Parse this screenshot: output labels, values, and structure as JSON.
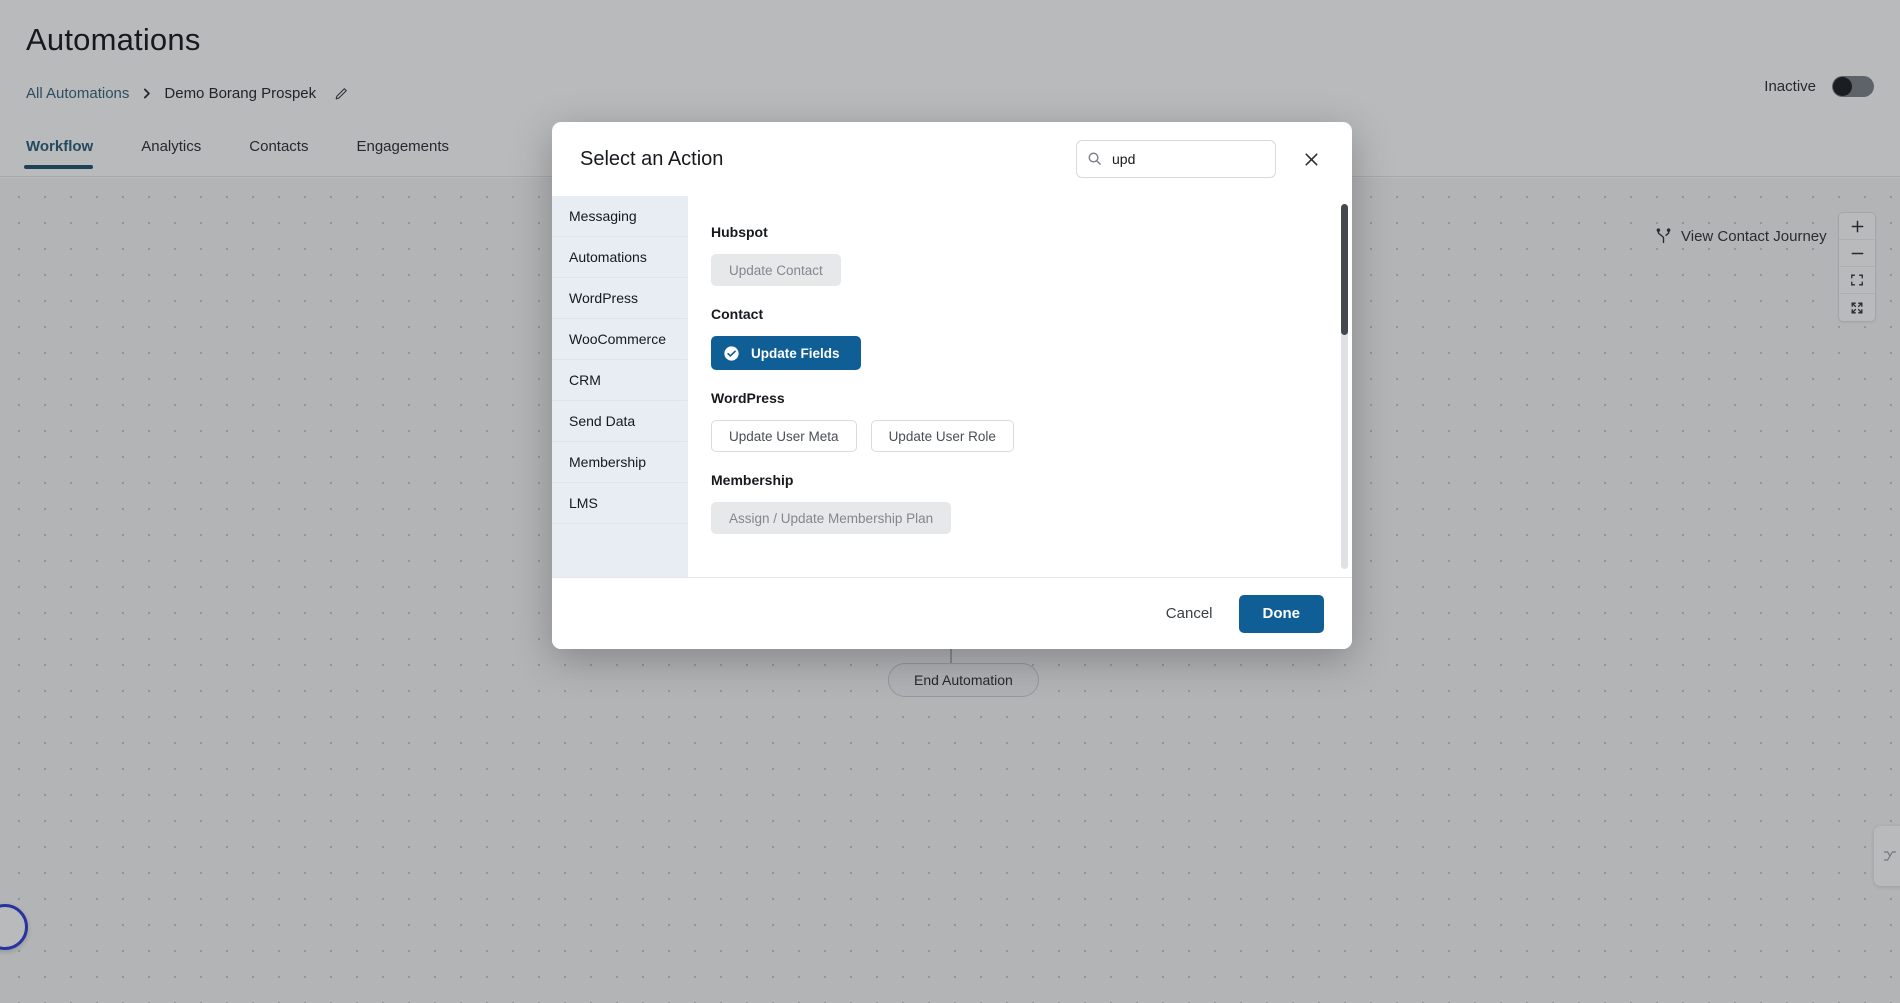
{
  "page": {
    "title": "Automations",
    "breadcrumb": {
      "root_label": "All Automations",
      "separator": "›",
      "current_label": "Demo Borang Prospek",
      "edit_icon": "pencil-icon"
    },
    "tabs": [
      {
        "label": "Workflow",
        "active": true
      },
      {
        "label": "Analytics",
        "active": false
      },
      {
        "label": "Contacts",
        "active": false
      },
      {
        "label": "Engagements",
        "active": false
      }
    ],
    "status": {
      "label": "Inactive",
      "enabled": false
    }
  },
  "canvas": {
    "view_journey_label": "View Contact Journey",
    "view_journey_icon": "journey-branch-icon",
    "zoom_controls": [
      {
        "icon": "plus-icon",
        "name": "zoom-in-button"
      },
      {
        "icon": "minus-icon",
        "name": "zoom-out-button"
      },
      {
        "icon": "fit-view-icon",
        "name": "fit-view-button"
      },
      {
        "icon": "expand-icon",
        "name": "fullscreen-button"
      }
    ],
    "end_node_label": "End Automation",
    "edge_panel_icon": "flow-minimap-icon"
  },
  "modal": {
    "title": "Select an Action",
    "search": {
      "value": "upd",
      "placeholder": "Search",
      "icon": "search-icon"
    },
    "close_icon": "close-icon",
    "categories": [
      {
        "label": "Messaging"
      },
      {
        "label": "Automations"
      },
      {
        "label": "WordPress"
      },
      {
        "label": "WooCommerce"
      },
      {
        "label": "CRM"
      },
      {
        "label": "Send Data"
      },
      {
        "label": "Membership"
      },
      {
        "label": "LMS"
      }
    ],
    "groups": [
      {
        "title": "Hubspot",
        "actions": [
          {
            "label": "Update Contact",
            "state": "disabled"
          }
        ]
      },
      {
        "title": "Contact",
        "actions": [
          {
            "label": "Update Fields",
            "state": "selected",
            "icon": "check-circle-icon"
          }
        ]
      },
      {
        "title": "WordPress",
        "actions": [
          {
            "label": "Update User Meta",
            "state": "outline"
          },
          {
            "label": "Update User Role",
            "state": "outline"
          }
        ]
      },
      {
        "title": "Membership",
        "actions": [
          {
            "label": "Assign / Update Membership Plan",
            "state": "disabled"
          }
        ]
      }
    ],
    "footer": {
      "cancel_label": "Cancel",
      "done_label": "Done"
    }
  },
  "colors": {
    "primary": "#0f5e96",
    "tab_active": "#2a5f7d",
    "link": "#35647f",
    "sidebar_bg": "#e7edf3",
    "disabled_bg": "#e7e8ea"
  }
}
